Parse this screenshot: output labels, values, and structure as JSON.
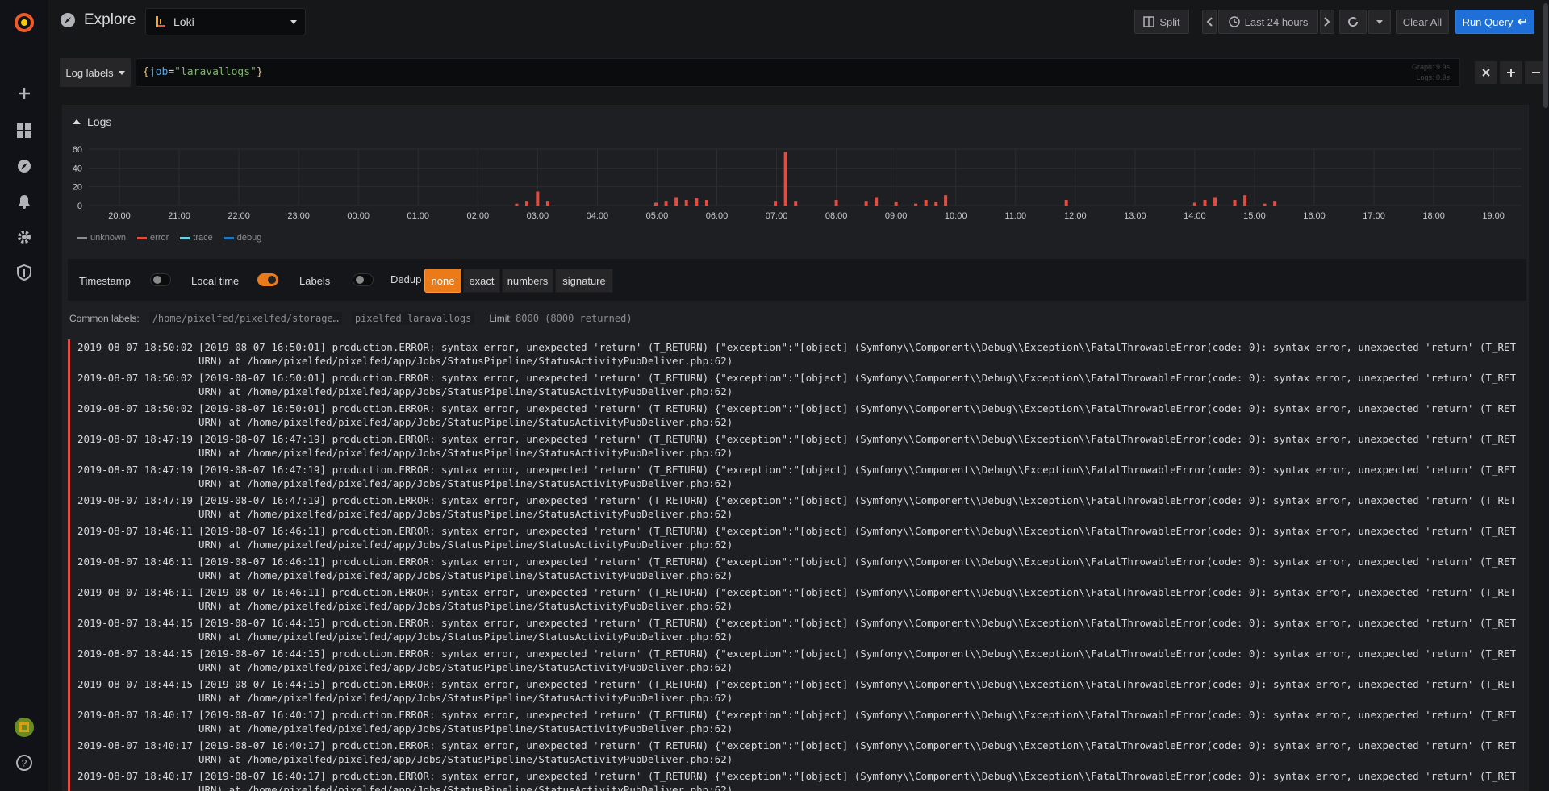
{
  "header": {
    "title": "Explore",
    "datasource": "Loki",
    "split_label": "Split",
    "time_range": "Last 24 hours",
    "clear_all_label": "Clear All",
    "run_query_label": "Run Query"
  },
  "query": {
    "log_labels_label": "Log labels",
    "expr_key": "job",
    "expr_eq": "=",
    "expr_value": "\"laravallogs\"",
    "meta_graph": "Graph: 9.9s",
    "meta_logs": "Logs: 0.9s"
  },
  "panel": {
    "title": "Logs"
  },
  "chart_data": {
    "type": "bar",
    "title": "",
    "ylim": [
      0,
      60
    ],
    "y_ticks": [
      "0",
      "20",
      "40",
      "60"
    ],
    "x_ticks": [
      "20:00",
      "21:00",
      "22:00",
      "23:00",
      "00:00",
      "01:00",
      "02:00",
      "03:00",
      "04:00",
      "05:00",
      "06:00",
      "07:00",
      "08:00",
      "09:00",
      "10:00",
      "11:00",
      "12:00",
      "13:00",
      "14:00",
      "15:00",
      "16:00",
      "17:00",
      "18:00",
      "19:00"
    ],
    "grid": true,
    "legend_position": "bottom-left",
    "series": [
      {
        "name": "error",
        "color": "#e24d42",
        "points": [
          {
            "t": 6.65,
            "v": 2
          },
          {
            "t": 6.82,
            "v": 5
          },
          {
            "t": 7.0,
            "v": 15
          },
          {
            "t": 7.17,
            "v": 5
          },
          {
            "t": 8.98,
            "v": 3
          },
          {
            "t": 9.15,
            "v": 5
          },
          {
            "t": 9.32,
            "v": 9
          },
          {
            "t": 9.49,
            "v": 6
          },
          {
            "t": 9.66,
            "v": 8
          },
          {
            "t": 9.83,
            "v": 6
          },
          {
            "t": 10.98,
            "v": 5
          },
          {
            "t": 11.15,
            "v": 57
          },
          {
            "t": 11.32,
            "v": 5
          },
          {
            "t": 12.0,
            "v": 6
          },
          {
            "t": 12.5,
            "v": 5
          },
          {
            "t": 12.67,
            "v": 9
          },
          {
            "t": 13.0,
            "v": 4
          },
          {
            "t": 13.33,
            "v": 2
          },
          {
            "t": 13.5,
            "v": 6
          },
          {
            "t": 13.67,
            "v": 4
          },
          {
            "t": 13.83,
            "v": 11
          },
          {
            "t": 15.85,
            "v": 6
          },
          {
            "t": 18.0,
            "v": 3
          },
          {
            "t": 18.17,
            "v": 6
          },
          {
            "t": 18.34,
            "v": 9
          },
          {
            "t": 18.67,
            "v": 6
          },
          {
            "t": 18.84,
            "v": 11
          },
          {
            "t": 19.17,
            "v": 2
          },
          {
            "t": 19.34,
            "v": 5
          }
        ]
      }
    ]
  },
  "legend": [
    {
      "label": "unknown",
      "color": "#8e8e8e"
    },
    {
      "label": "error",
      "color": "#e24d42"
    },
    {
      "label": "trace",
      "color": "#6ed0e0"
    },
    {
      "label": "debug",
      "color": "#1f78c1"
    }
  ],
  "options": {
    "timestamp_label": "Timestamp",
    "local_time_label": "Local time",
    "labels_label": "Labels",
    "dedup_label": "Dedup",
    "dedup_options": [
      "none",
      "exact",
      "numbers",
      "signature"
    ]
  },
  "common": {
    "label": "Common labels:",
    "chips": [
      "/home/pixelfed/pixelfed/storage…",
      "pixelfed laravallogs"
    ],
    "limit_label": "Limit:",
    "limit_value": "8000 (8000 returned)"
  },
  "log_rows": [
    {
      "ts": "2019-08-07 18:50:02",
      "msg": "[2019-08-07 16:50:01] production.ERROR: syntax error, unexpected 'return' (T_RETURN) {\"exception\":\"[object] (Symfony\\\\Component\\\\Debug\\\\Exception\\\\FatalThrowableError(code: 0): syntax error, unexpected 'return' (T_RETURN) at /home/pixelfed/pixelfed/app/Jobs/StatusPipeline/StatusActivityPubDeliver.php:62)"
    },
    {
      "ts": "2019-08-07 18:50:02",
      "msg": "[2019-08-07 16:50:01] production.ERROR: syntax error, unexpected 'return' (T_RETURN) {\"exception\":\"[object] (Symfony\\\\Component\\\\Debug\\\\Exception\\\\FatalThrowableError(code: 0): syntax error, unexpected 'return' (T_RETURN) at /home/pixelfed/pixelfed/app/Jobs/StatusPipeline/StatusActivityPubDeliver.php:62)"
    },
    {
      "ts": "2019-08-07 18:50:02",
      "msg": "[2019-08-07 16:50:01] production.ERROR: syntax error, unexpected 'return' (T_RETURN) {\"exception\":\"[object] (Symfony\\\\Component\\\\Debug\\\\Exception\\\\FatalThrowableError(code: 0): syntax error, unexpected 'return' (T_RETURN) at /home/pixelfed/pixelfed/app/Jobs/StatusPipeline/StatusActivityPubDeliver.php:62)"
    },
    {
      "ts": "2019-08-07 18:47:19",
      "msg": "[2019-08-07 16:47:19] production.ERROR: syntax error, unexpected 'return' (T_RETURN) {\"exception\":\"[object] (Symfony\\\\Component\\\\Debug\\\\Exception\\\\FatalThrowableError(code: 0): syntax error, unexpected 'return' (T_RETURN) at /home/pixelfed/pixelfed/app/Jobs/StatusPipeline/StatusActivityPubDeliver.php:62)"
    },
    {
      "ts": "2019-08-07 18:47:19",
      "msg": "[2019-08-07 16:47:19] production.ERROR: syntax error, unexpected 'return' (T_RETURN) {\"exception\":\"[object] (Symfony\\\\Component\\\\Debug\\\\Exception\\\\FatalThrowableError(code: 0): syntax error, unexpected 'return' (T_RETURN) at /home/pixelfed/pixelfed/app/Jobs/StatusPipeline/StatusActivityPubDeliver.php:62)"
    },
    {
      "ts": "2019-08-07 18:47:19",
      "msg": "[2019-08-07 16:47:19] production.ERROR: syntax error, unexpected 'return' (T_RETURN) {\"exception\":\"[object] (Symfony\\\\Component\\\\Debug\\\\Exception\\\\FatalThrowableError(code: 0): syntax error, unexpected 'return' (T_RETURN) at /home/pixelfed/pixelfed/app/Jobs/StatusPipeline/StatusActivityPubDeliver.php:62)"
    },
    {
      "ts": "2019-08-07 18:46:11",
      "msg": "[2019-08-07 16:46:11] production.ERROR: syntax error, unexpected 'return' (T_RETURN) {\"exception\":\"[object] (Symfony\\\\Component\\\\Debug\\\\Exception\\\\FatalThrowableError(code: 0): syntax error, unexpected 'return' (T_RETURN) at /home/pixelfed/pixelfed/app/Jobs/StatusPipeline/StatusActivityPubDeliver.php:62)"
    },
    {
      "ts": "2019-08-07 18:46:11",
      "msg": "[2019-08-07 16:46:11] production.ERROR: syntax error, unexpected 'return' (T_RETURN) {\"exception\":\"[object] (Symfony\\\\Component\\\\Debug\\\\Exception\\\\FatalThrowableError(code: 0): syntax error, unexpected 'return' (T_RETURN) at /home/pixelfed/pixelfed/app/Jobs/StatusPipeline/StatusActivityPubDeliver.php:62)"
    },
    {
      "ts": "2019-08-07 18:46:11",
      "msg": "[2019-08-07 16:46:11] production.ERROR: syntax error, unexpected 'return' (T_RETURN) {\"exception\":\"[object] (Symfony\\\\Component\\\\Debug\\\\Exception\\\\FatalThrowableError(code: 0): syntax error, unexpected 'return' (T_RETURN) at /home/pixelfed/pixelfed/app/Jobs/StatusPipeline/StatusActivityPubDeliver.php:62)"
    },
    {
      "ts": "2019-08-07 18:44:15",
      "msg": "[2019-08-07 16:44:15] production.ERROR: syntax error, unexpected 'return' (T_RETURN) {\"exception\":\"[object] (Symfony\\\\Component\\\\Debug\\\\Exception\\\\FatalThrowableError(code: 0): syntax error, unexpected 'return' (T_RETURN) at /home/pixelfed/pixelfed/app/Jobs/StatusPipeline/StatusActivityPubDeliver.php:62)"
    },
    {
      "ts": "2019-08-07 18:44:15",
      "msg": "[2019-08-07 16:44:15] production.ERROR: syntax error, unexpected 'return' (T_RETURN) {\"exception\":\"[object] (Symfony\\\\Component\\\\Debug\\\\Exception\\\\FatalThrowableError(code: 0): syntax error, unexpected 'return' (T_RETURN) at /home/pixelfed/pixelfed/app/Jobs/StatusPipeline/StatusActivityPubDeliver.php:62)"
    },
    {
      "ts": "2019-08-07 18:44:15",
      "msg": "[2019-08-07 16:44:15] production.ERROR: syntax error, unexpected 'return' (T_RETURN) {\"exception\":\"[object] (Symfony\\\\Component\\\\Debug\\\\Exception\\\\FatalThrowableError(code: 0): syntax error, unexpected 'return' (T_RETURN) at /home/pixelfed/pixelfed/app/Jobs/StatusPipeline/StatusActivityPubDeliver.php:62)"
    },
    {
      "ts": "2019-08-07 18:40:17",
      "msg": "[2019-08-07 16:40:17] production.ERROR: syntax error, unexpected 'return' (T_RETURN) {\"exception\":\"[object] (Symfony\\\\Component\\\\Debug\\\\Exception\\\\FatalThrowableError(code: 0): syntax error, unexpected 'return' (T_RETURN) at /home/pixelfed/pixelfed/app/Jobs/StatusPipeline/StatusActivityPubDeliver.php:62)"
    },
    {
      "ts": "2019-08-07 18:40:17",
      "msg": "[2019-08-07 16:40:17] production.ERROR: syntax error, unexpected 'return' (T_RETURN) {\"exception\":\"[object] (Symfony\\\\Component\\\\Debug\\\\Exception\\\\FatalThrowableError(code: 0): syntax error, unexpected 'return' (T_RETURN) at /home/pixelfed/pixelfed/app/Jobs/StatusPipeline/StatusActivityPubDeliver.php:62)"
    },
    {
      "ts": "2019-08-07 18:40:17",
      "msg": "[2019-08-07 16:40:17] production.ERROR: syntax error, unexpected 'return' (T_RETURN) {\"exception\":\"[object] (Symfony\\\\Component\\\\Debug\\\\Exception\\\\FatalThrowableError(code: 0): syntax error, unexpected 'return' (T_RETURN) at /home/pixelfed/pixelfed/app/Jobs/StatusPipeline/StatusActivityPubDeliver.php:62)"
    }
  ],
  "colors": {
    "accent": "#eb7b18",
    "primary": "#1f6fd8",
    "error": "#e24d42"
  }
}
